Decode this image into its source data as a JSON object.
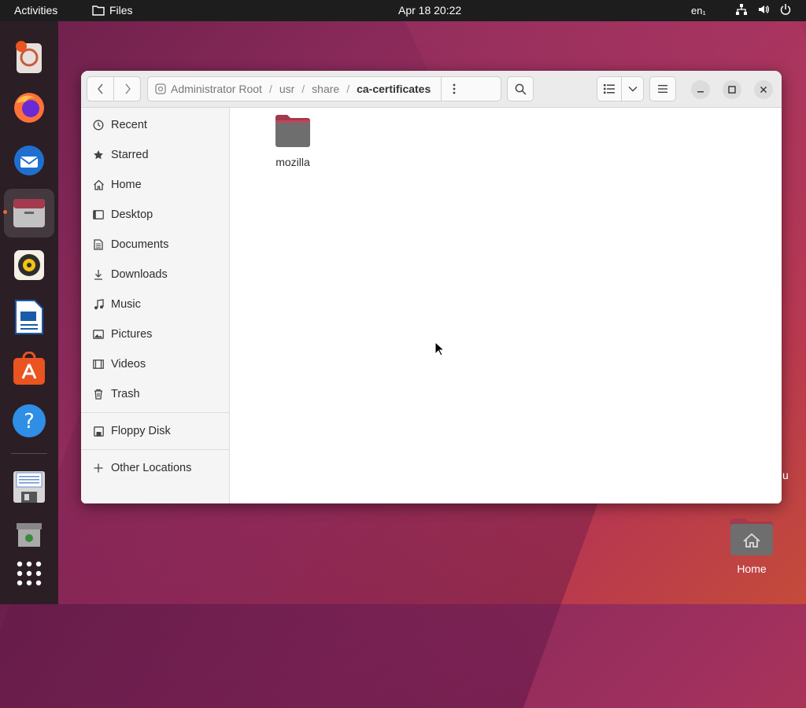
{
  "topbar": {
    "activities": "Activities",
    "app_name": "Files",
    "datetime": "Apr 18  20:22",
    "lang": "en₁"
  },
  "window": {
    "path": {
      "root": "Administrator Root",
      "segments": [
        "usr",
        "share"
      ],
      "current": "ca-certificates",
      "separator": "/"
    },
    "sidebar": {
      "items": [
        {
          "label": "Recent",
          "icon": "clock-icon"
        },
        {
          "label": "Starred",
          "icon": "star-icon"
        },
        {
          "label": "Home",
          "icon": "home-icon"
        },
        {
          "label": "Desktop",
          "icon": "desktop-icon"
        },
        {
          "label": "Documents",
          "icon": "document-icon"
        },
        {
          "label": "Downloads",
          "icon": "download-icon"
        },
        {
          "label": "Music",
          "icon": "music-icon"
        },
        {
          "label": "Pictures",
          "icon": "picture-icon"
        },
        {
          "label": "Videos",
          "icon": "video-icon"
        },
        {
          "label": "Trash",
          "icon": "trash-icon"
        }
      ],
      "devices": [
        {
          "label": "Floppy Disk",
          "icon": "floppy-icon"
        }
      ],
      "other": {
        "label": "Other Locations",
        "icon": "plus-icon"
      }
    },
    "files": [
      {
        "name": "mozilla",
        "type": "folder"
      }
    ]
  },
  "desktop": {
    "home_label": "Home",
    "partial_label": "u"
  },
  "colors": {
    "accent": "#e95420",
    "folder": "#6e6e6e",
    "folder_tab": "#a33a4e"
  }
}
